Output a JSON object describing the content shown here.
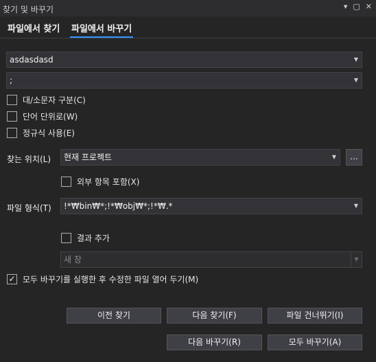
{
  "window": {
    "title": "찾기 및 바꾸기",
    "icons": [
      "dropdown-icon",
      "maximize-icon",
      "close-icon"
    ]
  },
  "tabs": [
    {
      "label": "파일에서 찾기",
      "active": false
    },
    {
      "label": "파일에서 바꾸기",
      "active": true
    }
  ],
  "find_field": {
    "value": "asdasdasd"
  },
  "replace_field": {
    "value": ";"
  },
  "options": {
    "match_case": {
      "label": "대/소문자 구분(C)",
      "checked": false
    },
    "whole_word": {
      "label": "단어 단위로(W)",
      "checked": false
    },
    "regex": {
      "label": "정규식 사용(E)",
      "checked": false
    }
  },
  "look_in": {
    "label": "찾는 위치(L)",
    "value": "현재 프로젝트",
    "browse_label": "..."
  },
  "external_items": {
    "label": "외부 항목 포함(X)",
    "checked": false
  },
  "file_types": {
    "label": "파일 형식(T)",
    "value": "!*₩bin₩*;!*₩obj₩*;!*₩.*"
  },
  "append_results": {
    "label": "결과 추가",
    "checked": false
  },
  "results_window": {
    "value": "새 창",
    "disabled": true
  },
  "keep_open": {
    "label": "모두 바꾸기를 실행한 후 수정한 파일 열어 두기(M)",
    "checked": true,
    "check_glyph": "✓"
  },
  "buttons": {
    "find_previous": "이전 찾기",
    "find_next": "다음 찾기(F)",
    "skip_file": "파일 건너뛰기(I)",
    "replace_next": "다음 바꾸기(R)",
    "replace_all": "모두 바꾸기(A)"
  },
  "colors": {
    "accent": "#3794ff",
    "background": "#252526"
  }
}
